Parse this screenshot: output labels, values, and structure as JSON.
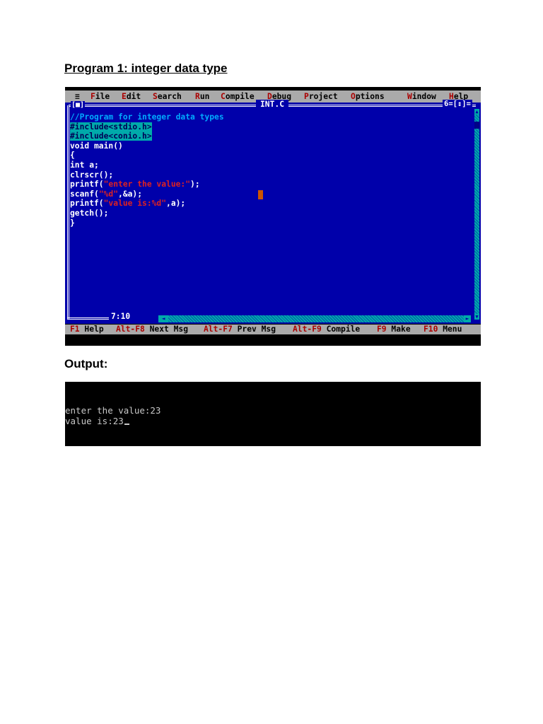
{
  "headings": {
    "program": "Program 1: integer data type",
    "output": "Output:"
  },
  "ide": {
    "menu": [
      {
        "icon": "≡",
        "hot": "",
        "rest": ""
      },
      {
        "hot": "F",
        "rest": "ile"
      },
      {
        "hot": "E",
        "rest": "dit"
      },
      {
        "hot": "S",
        "rest": "earch"
      },
      {
        "hot": "R",
        "rest": "un"
      },
      {
        "hot": "C",
        "rest": "ompile"
      },
      {
        "hot": "D",
        "rest": "ebug"
      },
      {
        "hot": "P",
        "rest": "roject"
      },
      {
        "hot": "O",
        "rest": "ptions"
      },
      {
        "hot": "W",
        "rest": "indow"
      },
      {
        "hot": "H",
        "rest": "elp"
      }
    ],
    "window": {
      "close": "[■]",
      "title": "INT.C",
      "number": "6=[↕]=",
      "cursor_pos": "7:10"
    },
    "code": {
      "comment": "//Program for integer data types",
      "include1": "#include<stdio.h>",
      "include2": "#include<conio.h>",
      "main": "void main()",
      "open_brace": "{",
      "decl": "int a;",
      "clrscr": "clrscr();",
      "printf1_pre": "printf(",
      "printf1_str": "\"enter the value:\"",
      "printf1_post": ");",
      "scanf_pre": "scanf(",
      "scanf_str": "\"%d\"",
      "scanf_post": ",&a);",
      "printf2_pre": "printf(",
      "printf2_str": "\"value is:%d\"",
      "printf2_post": ",a);",
      "getch": "getch();",
      "close_brace": "}"
    },
    "status": [
      {
        "key": "F1",
        "label": " Help"
      },
      {
        "key": "Alt-F8",
        "label": " Next Msg"
      },
      {
        "key": "Alt-F7",
        "label": " Prev Msg"
      },
      {
        "key": "Alt-F9",
        "label": " Compile"
      },
      {
        "key": "F9",
        "label": " Make"
      },
      {
        "key": "F10",
        "label": " Menu"
      }
    ]
  },
  "console": {
    "line1": "enter the value:23",
    "line2": "value is:23"
  },
  "colors": {
    "editor_bg": "#0000aa",
    "menubar_bg": "#aaaaaa",
    "hotkey": "#aa0000",
    "string": "#dd2222",
    "comment": "#00aaff"
  }
}
